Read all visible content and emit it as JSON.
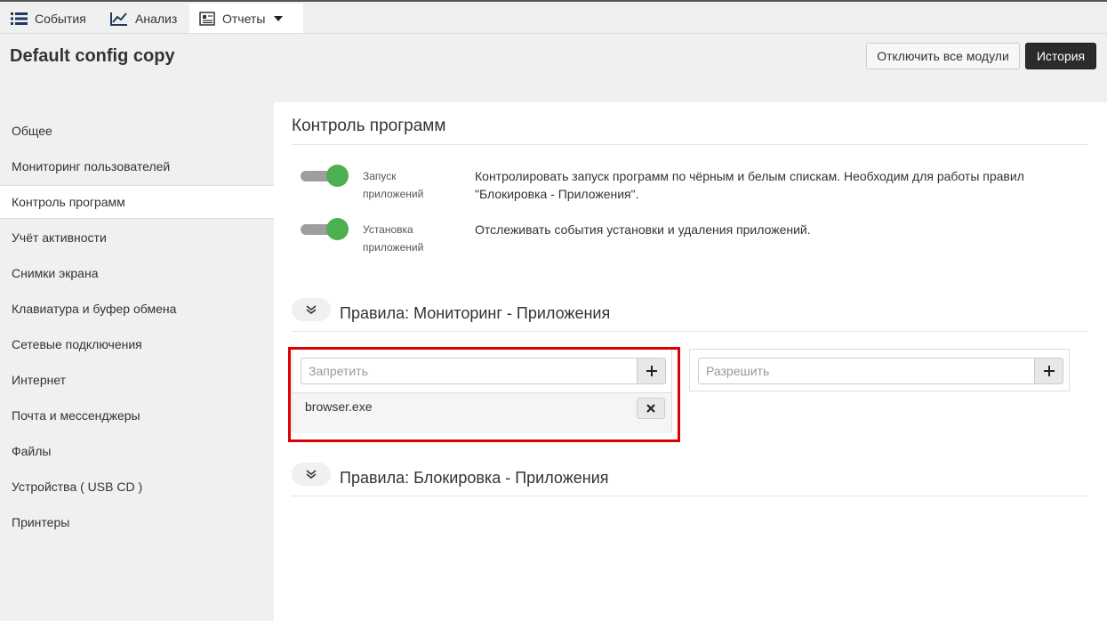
{
  "nav": {
    "tabs": [
      {
        "label": "События",
        "icon": "list-icon"
      },
      {
        "label": "Анализ",
        "icon": "line-chart-icon"
      },
      {
        "label": "Отчеты",
        "icon": "report-icon"
      }
    ]
  },
  "header": {
    "title": "Default config copy",
    "disable_all_label": "Отключить все модули",
    "history_label": "История"
  },
  "sidebar": {
    "items": [
      {
        "label": "Общее"
      },
      {
        "label": "Мониторинг пользователей"
      },
      {
        "label": "Контроль программ"
      },
      {
        "label": "Учёт активности"
      },
      {
        "label": "Снимки экрана"
      },
      {
        "label": "Клавиатура и буфер обмена"
      },
      {
        "label": "Сетевые подключения"
      },
      {
        "label": "Интернет"
      },
      {
        "label": "Почта и мессенджеры"
      },
      {
        "label": "Файлы"
      },
      {
        "label": "Устройства ( USB CD )"
      },
      {
        "label": "Принтеры"
      }
    ]
  },
  "main": {
    "title": "Контроль программ",
    "toggles": [
      {
        "label_line1": "Запуск",
        "label_line2": "приложений",
        "desc_line1": "Контролировать запуск программ по чёрным и белым спискам. Необходим для работы правил",
        "desc_line2": "\"Блокировка - Приложения\".",
        "state": "on"
      },
      {
        "label_line1": "Установка",
        "label_line2": "приложений",
        "desc_line1": "Отслеживать события установки и удаления приложений.",
        "state": "on"
      }
    ],
    "monitoring_rules": {
      "title": "Правила: Мониторинг - Приложения",
      "deny_placeholder": "Запретить",
      "allow_placeholder": "Разрешить",
      "deny_items": [
        "browser.exe"
      ]
    },
    "blocking_rules": {
      "title": "Правила: Блокировка - Приложения"
    }
  },
  "colors": {
    "toggle_on": "#4caf50",
    "highlight": "#dd0000",
    "history_button": "#2b2b2b"
  }
}
